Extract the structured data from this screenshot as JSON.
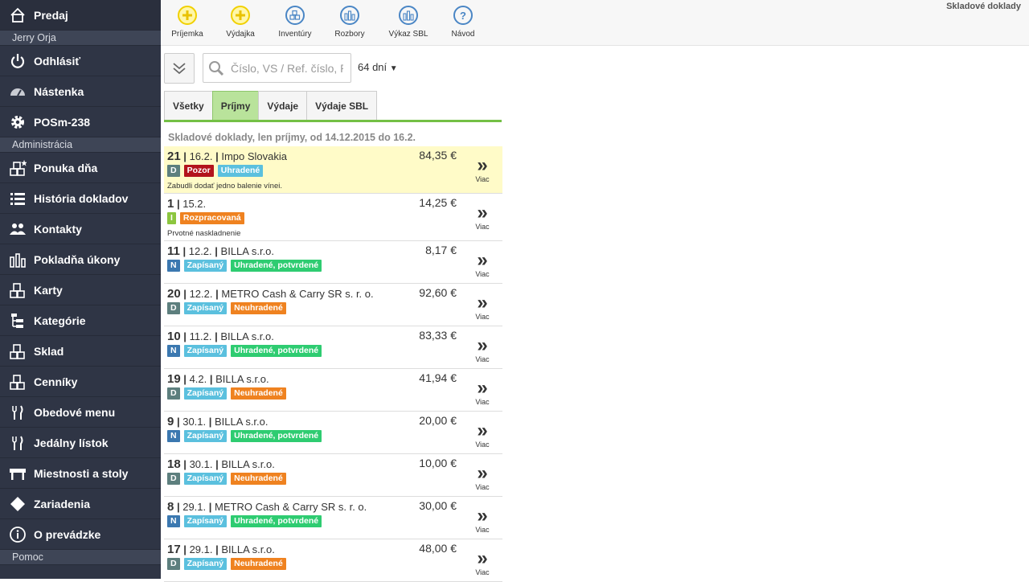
{
  "sidebar": {
    "items": [
      {
        "label": "Predaj",
        "icon": "home-icon"
      },
      {
        "section": "Jerry Orja"
      },
      {
        "label": "Odhlásiť",
        "icon": "power-icon"
      },
      {
        "label": "Nástenka",
        "icon": "dashboard-icon"
      },
      {
        "label": "POSm-238",
        "icon": "gear-icon"
      },
      {
        "section": "Administrácia"
      },
      {
        "label": "Ponuka dňa",
        "icon": "blocks-star-icon"
      },
      {
        "label": "História dokladov",
        "icon": "list-icon"
      },
      {
        "label": "Kontakty",
        "icon": "users-icon"
      },
      {
        "label": "Pokladňa úkony",
        "icon": "bars-icon"
      },
      {
        "label": "Karty",
        "icon": "blocks-icon"
      },
      {
        "label": "Kategórie",
        "icon": "tree-icon"
      },
      {
        "label": "Sklad",
        "icon": "blocks-icon"
      },
      {
        "label": "Cenníky",
        "icon": "blocks-icon"
      },
      {
        "label": "Obedové menu",
        "icon": "cutlery-icon"
      },
      {
        "label": "Jedálny lístok",
        "icon": "cutlery-icon"
      },
      {
        "label": "Miestnosti a stoly",
        "icon": "table-icon"
      },
      {
        "label": "Zariadenia",
        "icon": "diamond-icon"
      },
      {
        "label": "O prevádzke",
        "icon": "info-icon"
      },
      {
        "section": "Pomoc"
      }
    ]
  },
  "toolbar": {
    "buttons": [
      {
        "label": "Príjemka",
        "icon": "plus-icon"
      },
      {
        "label": "Výdajka",
        "icon": "plus-icon"
      },
      {
        "label": "Inventúry",
        "icon": "blocks-icon"
      },
      {
        "label": "Rozbory",
        "icon": "bars-icon"
      },
      {
        "label": "Výkaz SBL",
        "icon": "bars-icon"
      },
      {
        "label": "Návod",
        "icon": "question-icon"
      }
    ],
    "page_name": "Skladové doklady"
  },
  "filter": {
    "search_placeholder": "Číslo, VS / Ref. číslo, P",
    "days": "64 dní",
    "days_arrow": "▼"
  },
  "tabs": [
    {
      "label": "Všetky",
      "active": false
    },
    {
      "label": "Príjmy",
      "active": true
    },
    {
      "label": "Výdaje",
      "active": false
    },
    {
      "label": "Výdaje SBL",
      "active": false
    }
  ],
  "list_title": "Skladové doklady, len príjmy, od 14.12.2015 do 16.2.",
  "more_label": "Viac",
  "more_arrows": "»",
  "documents": [
    {
      "num": "21",
      "date": "16.2.",
      "partner": "Impo Slovakia",
      "amount": "84,35 €",
      "badges": [
        {
          "text": "D",
          "cls": "b-D"
        },
        {
          "text": "Pozor",
          "cls": "b-red"
        },
        {
          "text": "Uhradené",
          "cls": "b-blue"
        }
      ],
      "note": "Zabudli dodať jedno balenie vínei.",
      "highlight": true
    },
    {
      "num": "1",
      "date": "15.2.",
      "partner": "",
      "amount": "14,25 €",
      "badges": [
        {
          "text": "I",
          "cls": "b-I"
        },
        {
          "text": "Rozpracovaná",
          "cls": "b-orange"
        }
      ],
      "note": "Prvotné naskladnenie",
      "highlight": false
    },
    {
      "num": "11",
      "date": "12.2.",
      "partner": "BILLA s.r.o.",
      "amount": "8,17 €",
      "badges": [
        {
          "text": "N",
          "cls": "b-N"
        },
        {
          "text": "Zapísaný",
          "cls": "b-blue"
        },
        {
          "text": "Uhradené, potvrdené",
          "cls": "b-green"
        }
      ],
      "note": "",
      "highlight": false
    },
    {
      "num": "20",
      "date": "12.2.",
      "partner": "METRO Cash & Carry SR s. r. o.",
      "amount": "92,60 €",
      "badges": [
        {
          "text": "D",
          "cls": "b-D"
        },
        {
          "text": "Zapísaný",
          "cls": "b-blue"
        },
        {
          "text": "Neuhradené",
          "cls": "b-orange"
        }
      ],
      "note": "",
      "highlight": false
    },
    {
      "num": "10",
      "date": "11.2.",
      "partner": "BILLA s.r.o.",
      "amount": "83,33 €",
      "badges": [
        {
          "text": "N",
          "cls": "b-N"
        },
        {
          "text": "Zapísaný",
          "cls": "b-blue"
        },
        {
          "text": "Uhradené, potvrdené",
          "cls": "b-green"
        }
      ],
      "note": "",
      "highlight": false
    },
    {
      "num": "19",
      "date": "4.2.",
      "partner": "BILLA s.r.o.",
      "amount": "41,94 €",
      "badges": [
        {
          "text": "D",
          "cls": "b-D"
        },
        {
          "text": "Zapísaný",
          "cls": "b-blue"
        },
        {
          "text": "Neuhradené",
          "cls": "b-orange"
        }
      ],
      "note": "",
      "highlight": false
    },
    {
      "num": "9",
      "date": "30.1.",
      "partner": "BILLA s.r.o.",
      "amount": "20,00 €",
      "badges": [
        {
          "text": "N",
          "cls": "b-N"
        },
        {
          "text": "Zapísaný",
          "cls": "b-blue"
        },
        {
          "text": "Uhradené, potvrdené",
          "cls": "b-green"
        }
      ],
      "note": "",
      "highlight": false
    },
    {
      "num": "18",
      "date": "30.1.",
      "partner": "BILLA s.r.o.",
      "amount": "10,00 €",
      "badges": [
        {
          "text": "D",
          "cls": "b-D"
        },
        {
          "text": "Zapísaný",
          "cls": "b-blue"
        },
        {
          "text": "Neuhradené",
          "cls": "b-orange"
        }
      ],
      "note": "",
      "highlight": false
    },
    {
      "num": "8",
      "date": "29.1.",
      "partner": "METRO Cash & Carry SR s. r. o.",
      "amount": "30,00 €",
      "badges": [
        {
          "text": "N",
          "cls": "b-N"
        },
        {
          "text": "Zapísaný",
          "cls": "b-blue"
        },
        {
          "text": "Uhradené, potvrdené",
          "cls": "b-green"
        }
      ],
      "note": "",
      "highlight": false
    },
    {
      "num": "17",
      "date": "29.1.",
      "partner": "BILLA s.r.o.",
      "amount": "48,00 €",
      "badges": [
        {
          "text": "D",
          "cls": "b-D"
        },
        {
          "text": "Zapísaný",
          "cls": "b-blue"
        },
        {
          "text": "Neuhradené",
          "cls": "b-orange"
        }
      ],
      "note": "",
      "highlight": false
    }
  ]
}
